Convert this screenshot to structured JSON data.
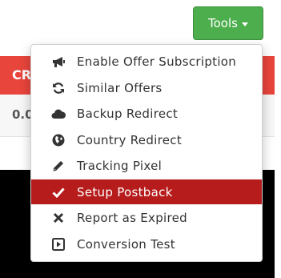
{
  "toolbar": {
    "tools_label": "Tools"
  },
  "background": {
    "header_text": "CR",
    "row_text": "0.0"
  },
  "menu": {
    "items": [
      {
        "label": "Enable Offer Subscription",
        "icon": "bullhorn-icon",
        "active": false
      },
      {
        "label": "Similar Offers",
        "icon": "refresh-icon",
        "active": false
      },
      {
        "label": "Backup Redirect",
        "icon": "cloud-icon",
        "active": false
      },
      {
        "label": "Country Redirect",
        "icon": "globe-icon",
        "active": false
      },
      {
        "label": "Tracking Pixel",
        "icon": "pencil-icon",
        "active": false
      },
      {
        "label": "Setup Postback",
        "icon": "check-icon",
        "active": true
      },
      {
        "label": "Report as Expired",
        "icon": "close-icon",
        "active": false
      },
      {
        "label": "Conversion Test",
        "icon": "play-icon",
        "active": false
      }
    ]
  },
  "colors": {
    "tools_button": "#4cae4c",
    "active_item": "#b71c1c",
    "background_header": "#e8453c"
  }
}
